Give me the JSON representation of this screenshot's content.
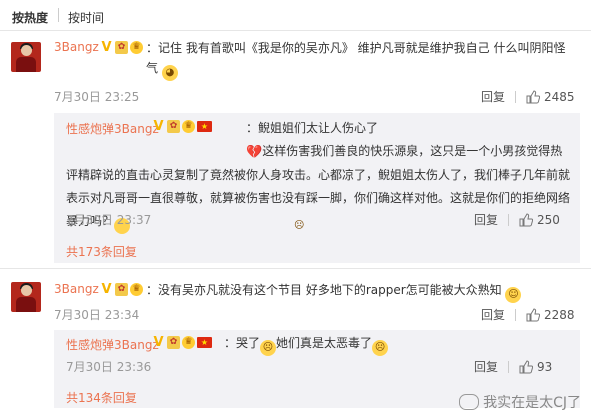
{
  "sort": {
    "hot": "按热度",
    "time": "按时间"
  },
  "comments": [
    {
      "user": "3Bangz",
      "text": "：记住 我有首歌叫《我是你的吴亦凡》 维护凡哥就是维护我自己 什么叫阴阳怪气",
      "time": "7月30日 23:25",
      "reply_label": "回复",
      "likes": "2485",
      "reply": {
        "user": "性感炮弹3Bangz",
        "text_a": "：鲵姐姐们太让人伤心了",
        "text_b": "这样伤害我们善良的快乐源泉，这只是一个小男孩觉得热评精辟说的直击心灵复制了竟然被你人身攻击。心都凉了，鲵姐姐太伤人了，我们棒子几年前就表示对凡哥哥一直很尊敬，就算被伤害也没有踩一脚，你们确这样对他。这就是你们的拒绝网络暴力吗？",
        "time": "7月30日 23:37",
        "reply_label": "回复",
        "likes": "250"
      },
      "more": "共173条回复"
    },
    {
      "user": "3Bangz",
      "text": "：没有吴亦凡就没有这个节目 好多地下的rapper怎可能被大众熟知",
      "time": "7月30日 23:34",
      "reply_label": "回复",
      "likes": "2288",
      "reply": {
        "user": "性感炮弹3Bangz",
        "text_a": "：哭了",
        "text_b": "她们真是太恶毒了",
        "time": "7月30日 23:36",
        "reply_label": "回复",
        "likes": "93"
      },
      "more": "共134条回复"
    }
  ],
  "watermark": "我实在是太CJ了",
  "colors": {
    "accent": "#eb7350",
    "subbox": "#f2f2f5"
  }
}
